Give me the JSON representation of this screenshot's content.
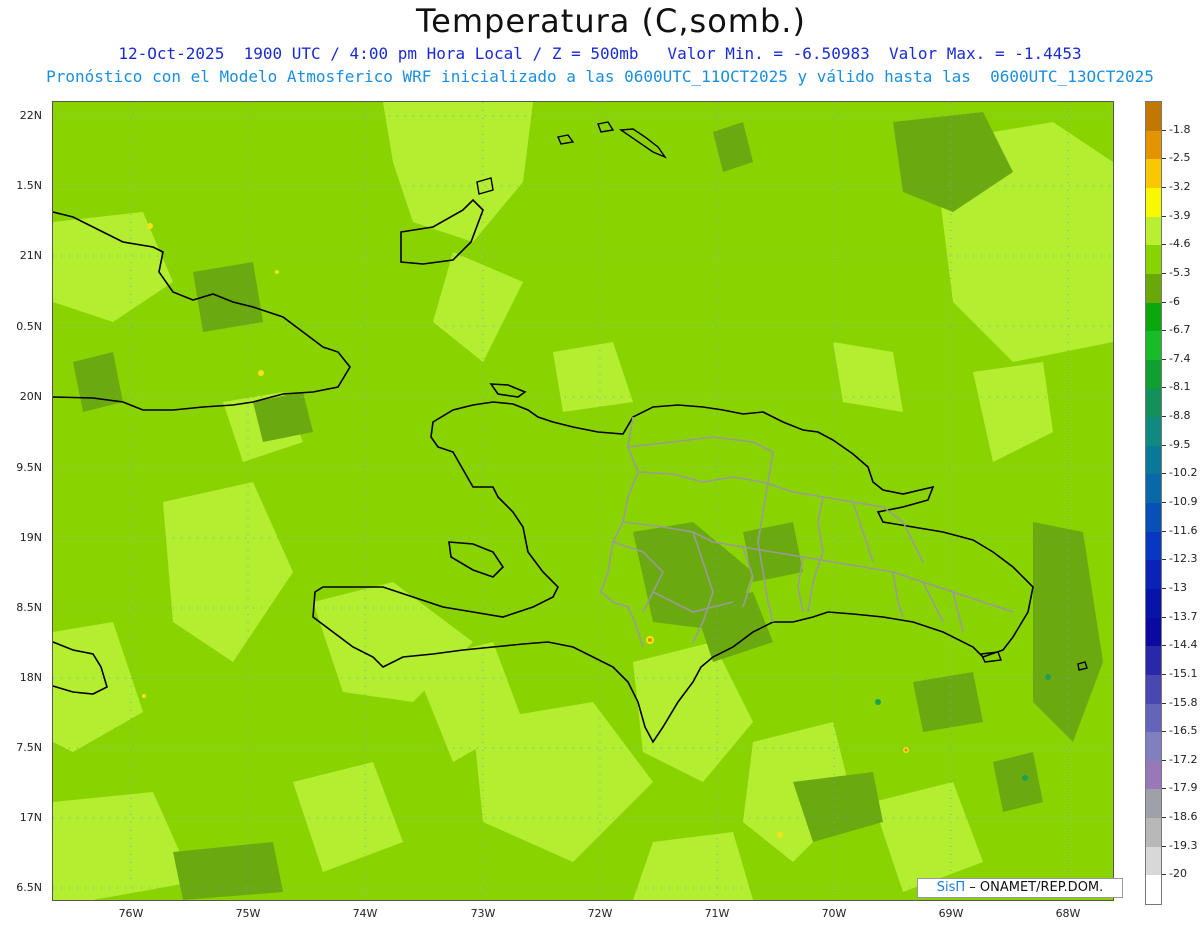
{
  "title": "Temperatura (C,somb.)",
  "subtitle_line1": "12-Oct-2025  1900 UTC / 4:00 pm Hora Local / Z = 500mb   Valor Min. = -6.50983  Valor Max. = -1.4453",
  "subtitle_line2": "Pronóstico con el Modelo Atmosferico WRF inicializado a las 0600UTC_11OCT2025 y válido hasta las  0600UTC_13OCT2025",
  "latitude_labels": [
    "22N",
    "1.5N",
    "21N",
    "0.5N",
    "20N",
    "9.5N",
    "19N",
    "8.5N",
    "18N",
    "7.5N",
    "17N",
    "6.5N"
  ],
  "longitude_labels": [
    "76W",
    "75W",
    "74W",
    "73W",
    "72W",
    "71W",
    "70W",
    "69W",
    "68W"
  ],
  "colorbar": {
    "labels": [
      "-1.8",
      "-2.5",
      "-3.2",
      "-3.9",
      "-4.6",
      "-5.3",
      "-6",
      "-6.7",
      "-7.4",
      "-8.1",
      "-8.8",
      "-9.5",
      "-10.2",
      "-10.9",
      "-11.6",
      "-12.3",
      "-13",
      "-13.7",
      "-14.4",
      "-15.1",
      "-15.8",
      "-16.5",
      "-17.2",
      "-17.9",
      "-18.6",
      "-19.3",
      "-20"
    ],
    "colors": [
      "#c07800",
      "#e49400",
      "#f8c800",
      "#f8f800",
      "#b8f030",
      "#88d400",
      "#6aa80a",
      "#0aa80a",
      "#18bb28",
      "#10a030",
      "#12925a",
      "#108a80",
      "#0a7898",
      "#0868a8",
      "#0850b8",
      "#0838c0",
      "#0a22b8",
      "#0814a8",
      "#0a0aa0",
      "#2828a8",
      "#4848b0",
      "#6464b8",
      "#8080c0",
      "#9878b8",
      "#a0a0a8",
      "#b8b8b8",
      "#d8d8d8",
      "#ffffff"
    ]
  },
  "credit": {
    "brand": "SisΠ",
    "org": " – ONAMET/REP.DOM."
  },
  "colors": {
    "base_field": "#89d400",
    "light_field": "#b4ee30",
    "dark_field": "#6aaa10",
    "coast": "#000000",
    "province_borders": "#999999"
  }
}
